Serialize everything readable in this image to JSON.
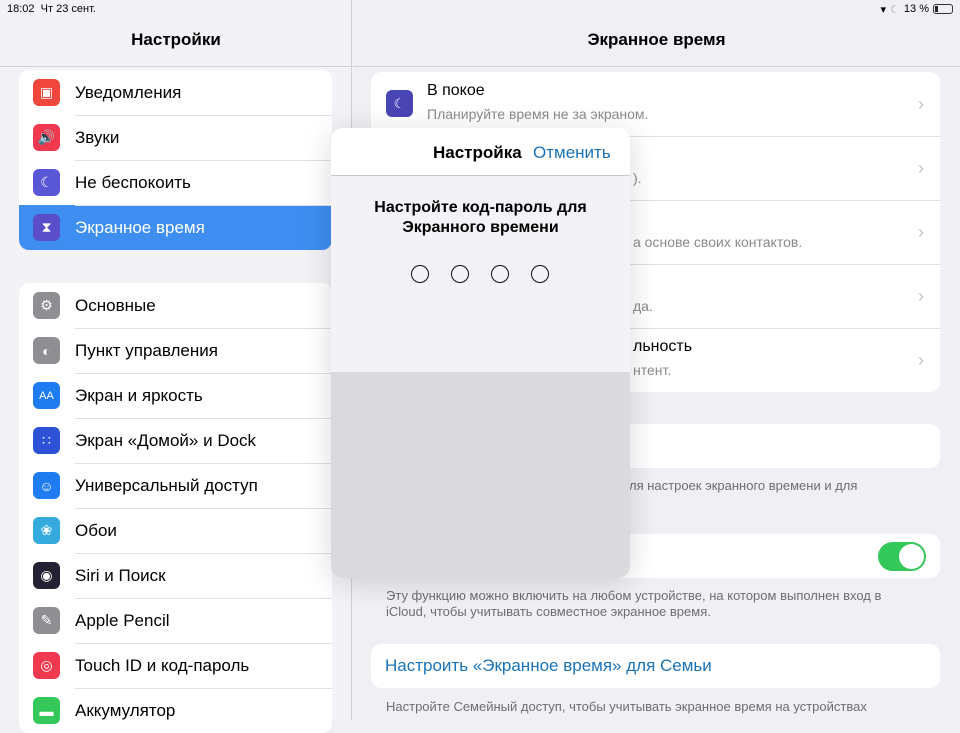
{
  "status": {
    "time": "18:02",
    "date": "Чт 23 сент.",
    "battery": "13 %",
    "icons": [
      "wifi-icon",
      "moon-icon",
      "battery-icon"
    ]
  },
  "sidebar": {
    "title": "Настройки",
    "groups": [
      [
        {
          "label": "Уведомления",
          "icon": "notifications-icon",
          "color": "#f0463c"
        },
        {
          "label": "Звуки",
          "icon": "sounds-icon",
          "color": "#f0384e"
        },
        {
          "label": "Не беспокоить",
          "icon": "moon-icon",
          "color": "#5a57d6"
        },
        {
          "label": "Экранное время",
          "icon": "hourglass-icon",
          "color": "#5a4fc9",
          "selected": true
        }
      ],
      [
        {
          "label": "Основные",
          "icon": "gear-icon",
          "color": "#8e8e93"
        },
        {
          "label": "Пункт управления",
          "icon": "switches-icon",
          "color": "#8e8e93"
        },
        {
          "label": "Экран и яркость",
          "icon": "text-size-icon",
          "color": "#1e7cf0"
        },
        {
          "label": "Экран «Домой» и Dock",
          "icon": "home-grid-icon",
          "color": "#2d52d6"
        },
        {
          "label": "Универсальный доступ",
          "icon": "accessibility-icon",
          "color": "#1e7cf0"
        },
        {
          "label": "Обои",
          "icon": "wallpaper-icon",
          "color": "#35aadc"
        },
        {
          "label": "Siri и Поиск",
          "icon": "siri-icon",
          "color": "#222233"
        },
        {
          "label": "Apple Pencil",
          "icon": "pencil-icon",
          "color": "#8e8e93"
        },
        {
          "label": "Touch ID и код-пароль",
          "icon": "fingerprint-icon",
          "color": "#f0384e"
        },
        {
          "label": "Аккумулятор",
          "icon": "battery-icon",
          "color": "#34c759"
        }
      ]
    ]
  },
  "main": {
    "title": "Экранное время",
    "rows": [
      {
        "title": "В покое",
        "subtitle": "Планируйте время не за экраном."
      },
      {
        "title": "",
        "subtitle": ")."
      },
      {
        "title": "",
        "subtitle": "а основе своих контактов."
      },
      {
        "title": "",
        "subtitle": "да."
      },
      {
        "title": "льность",
        "subtitle": "нтент."
      }
    ],
    "footer1": "ля настроек экранного времени и для",
    "share_toggle_on": true,
    "footer2": "Эту функцию можно включить на любом устройстве, на котором выполнен вход в iCloud, чтобы учитывать совместное экранное время.",
    "family_link": "Настроить «Экранное время» для Семьи",
    "footer3": "Настройте Семейный доступ, чтобы учитывать экранное время на устройствах"
  },
  "modal": {
    "title": "Настройка",
    "cancel": "Отменить",
    "prompt": "Настройте код-пароль для Экранного времени",
    "passcode_length": 4,
    "entered": 0
  },
  "colors": {
    "accent": "#1a73b8",
    "selected": "#3d8ef0",
    "toggle": "#34c759"
  }
}
